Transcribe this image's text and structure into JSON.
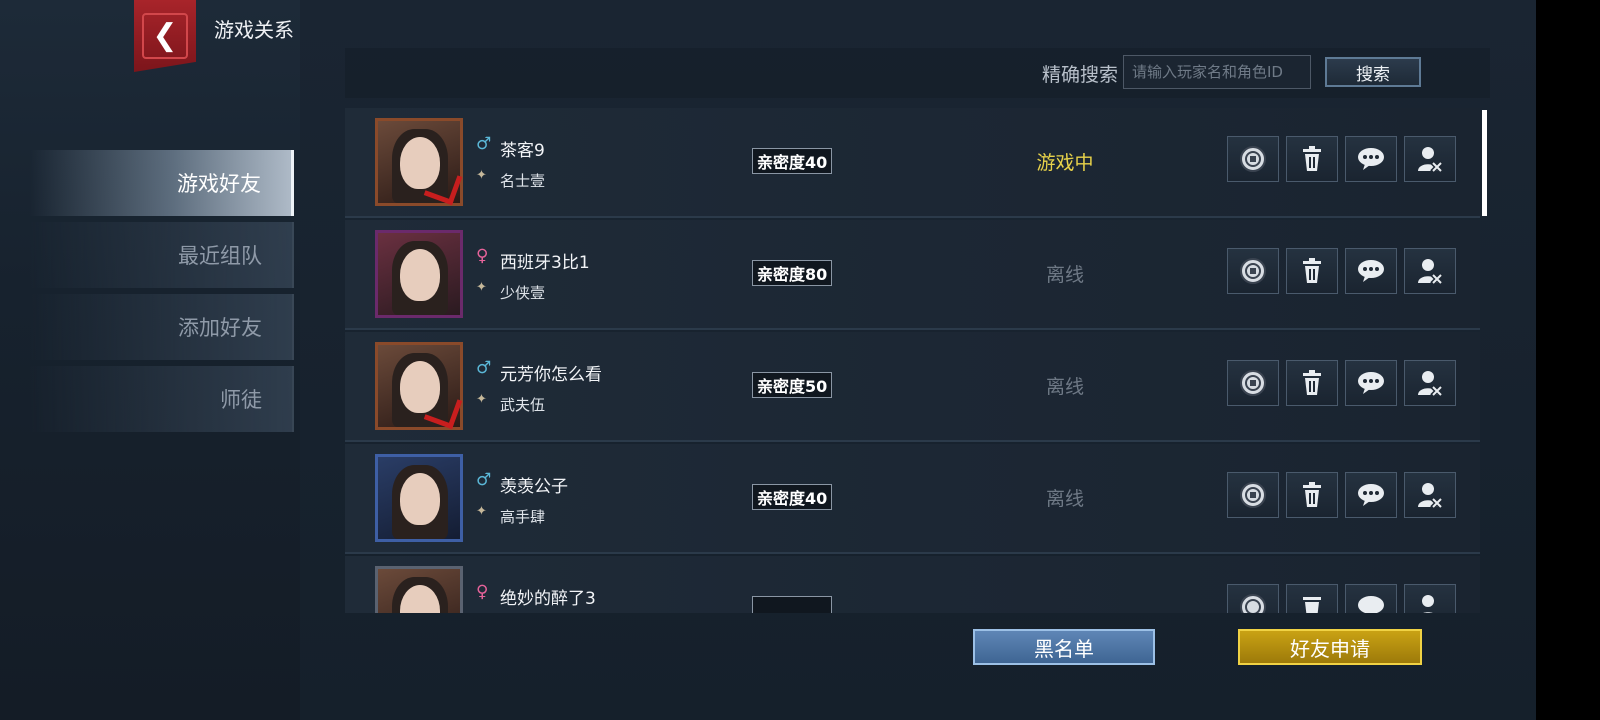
{
  "header": {
    "title": "游戏关系",
    "back_icon": "back-arrow-icon"
  },
  "sidebar": {
    "tabs": [
      {
        "label": "游戏好友",
        "active": true
      },
      {
        "label": "最近组队",
        "active": false
      },
      {
        "label": "添加好友",
        "active": false
      },
      {
        "label": "师徒",
        "active": false
      }
    ]
  },
  "search": {
    "label": "精确搜索",
    "placeholder": "请输入玩家名和角色ID",
    "value": "",
    "button_label": "搜索"
  },
  "friends": [
    {
      "name": "茶客9",
      "title": "名士壹",
      "gender": "male",
      "intimacy": "亲密度40",
      "status": "游戏中",
      "online": true
    },
    {
      "name": "西班牙3比1",
      "title": "少侠壹",
      "gender": "female",
      "intimacy": "亲密度80",
      "status": "离线",
      "online": false
    },
    {
      "name": "元芳你怎么看",
      "title": "武夫伍",
      "gender": "male",
      "intimacy": "亲密度50",
      "status": "离线",
      "online": false
    },
    {
      "name": "羡羡公子",
      "title": "高手肆",
      "gender": "male",
      "intimacy": "亲密度40",
      "status": "离线",
      "online": false
    },
    {
      "name": "绝妙的醉了3",
      "title": "",
      "gender": "female",
      "intimacy": "",
      "status": "",
      "online": false
    }
  ],
  "row_actions": [
    "coin-icon",
    "trash-icon",
    "chat-bubble-icon",
    "remove-friend-icon"
  ],
  "footer": {
    "blacklist_label": "黑名单",
    "friend_request_label": "好友申请"
  },
  "colors": {
    "online": "#e8d24a",
    "offline": "#6f7986",
    "accent_red": "#a8242a",
    "accent_gold": "#c9a214",
    "accent_blue": "#5f86b6"
  }
}
